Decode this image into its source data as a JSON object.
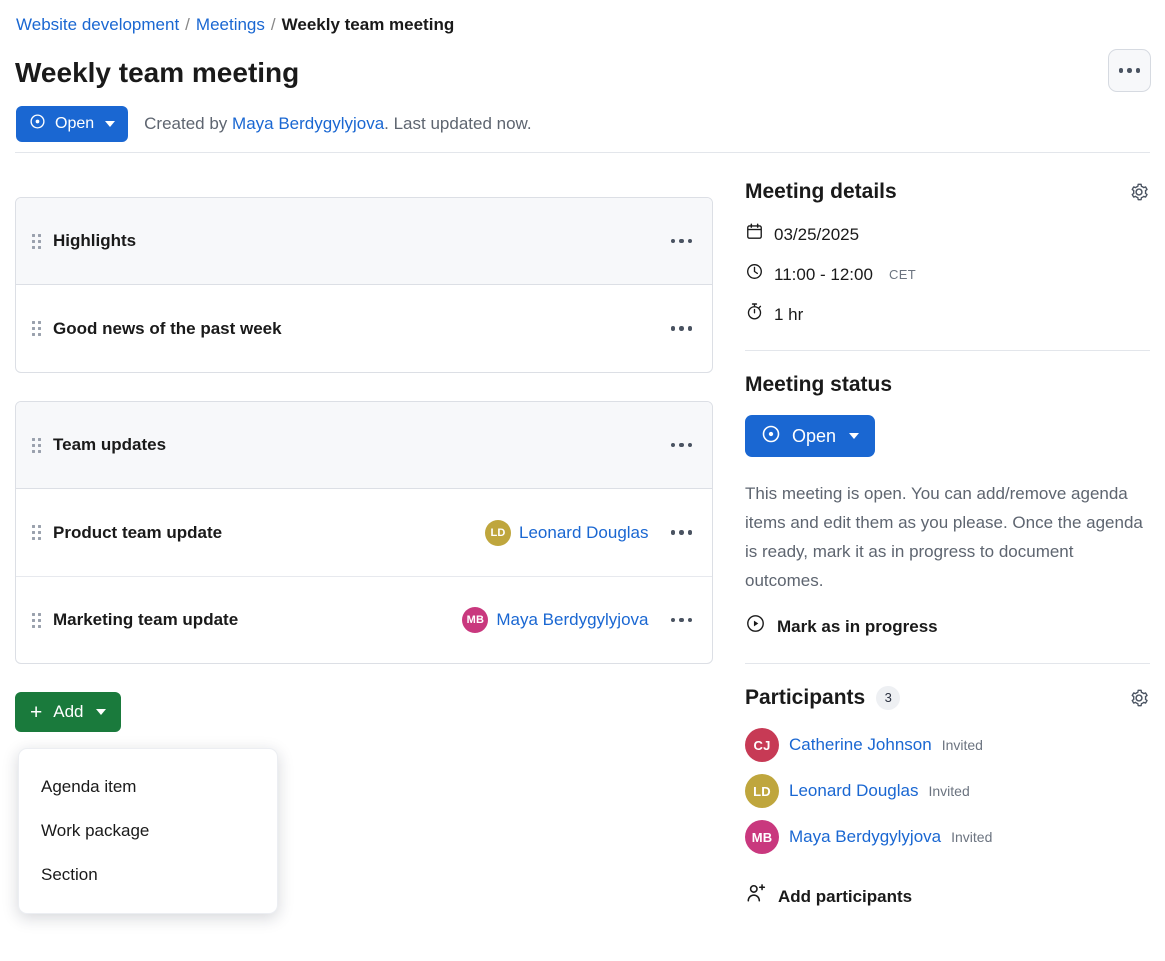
{
  "breadcrumb": {
    "items": [
      {
        "label": "Website development",
        "current": false
      },
      {
        "label": "Meetings",
        "current": false
      },
      {
        "label": "Weekly team meeting",
        "current": true
      }
    ],
    "separator": "/"
  },
  "header": {
    "title": "Weekly team meeting",
    "more_icon": "ellipsis-icon",
    "status_label": "Open",
    "status_icon": "status-open-icon",
    "created_prefix": "Created by ",
    "created_by": "Maya Berdygylyjova",
    "created_suffix": ". Last updated now."
  },
  "agenda": {
    "sections": [
      {
        "header": {
          "title": "Highlights",
          "more_icon": "ellipsis-icon",
          "drag_icon": "drag-handle-icon"
        },
        "items": [
          {
            "title": "Good news of the past week",
            "assignee": null,
            "more_icon": "ellipsis-icon",
            "drag_icon": "drag-handle-icon"
          }
        ]
      },
      {
        "header": {
          "title": "Team updates",
          "more_icon": "ellipsis-icon",
          "drag_icon": "drag-handle-icon"
        },
        "items": [
          {
            "title": "Product team update",
            "assignee": {
              "name": "Leonard Douglas",
              "initials": "LD",
              "color": "#bfa63d"
            },
            "more_icon": "ellipsis-icon",
            "drag_icon": "drag-handle-icon"
          },
          {
            "title": "Marketing team update",
            "assignee": {
              "name": "Maya Berdygylyjova",
              "initials": "MB",
              "color": "#c9387e"
            },
            "more_icon": "ellipsis-icon",
            "drag_icon": "drag-handle-icon"
          }
        ]
      }
    ],
    "add_button": {
      "label": "Add",
      "plus_icon": "plus-icon",
      "caret_icon": "chevron-down-icon"
    },
    "add_menu": {
      "open": true,
      "items": [
        {
          "label": "Agenda item"
        },
        {
          "label": "Work package"
        },
        {
          "label": "Section"
        }
      ]
    }
  },
  "meeting_details": {
    "title": "Meeting details",
    "settings_icon": "gear-icon",
    "date": "03/25/2025",
    "date_icon": "calendar-icon",
    "time": "11:00 - 12:00",
    "time_icon": "clock-icon",
    "timezone": "CET",
    "duration": "1 hr",
    "duration_icon": "stopwatch-icon"
  },
  "meeting_status": {
    "title": "Meeting status",
    "status_label": "Open",
    "status_icon": "status-open-icon",
    "caret_icon": "chevron-down-icon",
    "description": "This meeting is open. You can add/remove agenda items and edit them as you please. Once the agenda is ready, mark it as in progress to document outcomes.",
    "action_label": "Mark as in progress",
    "action_icon": "play-circle-icon"
  },
  "participants": {
    "title": "Participants",
    "count": "3",
    "settings_icon": "gear-icon",
    "list": [
      {
        "name": "Catherine Johnson",
        "initials": "CJ",
        "state": "Invited",
        "color": "#c73a55"
      },
      {
        "name": "Leonard Douglas",
        "initials": "LD",
        "state": "Invited",
        "color": "#bfa63d"
      },
      {
        "name": "Maya Berdygylyjova",
        "initials": "MB",
        "state": "Invited",
        "color": "#c9387e"
      }
    ],
    "add_label": "Add participants",
    "add_icon": "user-plus-icon"
  },
  "colors": {
    "accent_blue": "#1a67d2",
    "accent_green": "#1a7a3c",
    "muted_text": "#5e6570",
    "section_bg": "#f7f8fa",
    "border": "#dcdfe5"
  }
}
